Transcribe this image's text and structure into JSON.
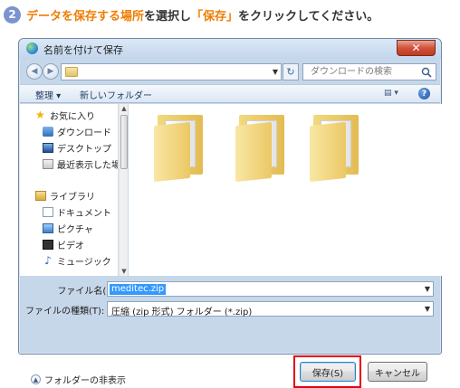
{
  "step": {
    "number": "2",
    "text_part1": "データを保存する場所",
    "text_part2": "を選択し",
    "text_part3": "「保存」",
    "text_part4": "をクリックしてください。"
  },
  "dialog": {
    "title": "名前を付けて保存",
    "close_glyph": "✕",
    "back_glyph": "◀",
    "forward_glyph": "▶",
    "address_dropdown_glyph": "▼",
    "refresh_glyph": "↻",
    "search_placeholder": "ダウンロードの検索"
  },
  "commandbar": {
    "organize_label": "整理 ▾",
    "new_folder_label": "新しいフォルダー",
    "views_label": "▤ ▾",
    "help_glyph": "?"
  },
  "sidebar": {
    "items": [
      {
        "label": "お気に入り",
        "icon": "star-icon"
      },
      {
        "label": "ダウンロード",
        "icon": "download-icon"
      },
      {
        "label": "デスクトップ",
        "icon": "desktop-icon"
      },
      {
        "label": "最近表示した場所",
        "icon": "recent-places-icon"
      },
      {
        "label": "ライブラリ",
        "icon": "library-icon"
      },
      {
        "label": "ドキュメント",
        "icon": "documents-icon"
      },
      {
        "label": "ピクチャ",
        "icon": "pictures-icon"
      },
      {
        "label": "ビデオ",
        "icon": "videos-icon"
      },
      {
        "label": "ミュージック",
        "icon": "music-icon"
      }
    ]
  },
  "form": {
    "filename_label": "ファイル名(N):",
    "filename_value": "meditec.zip",
    "filetype_label": "ファイルの種類(T):",
    "filetype_value": "圧縮 (zip 形式) フォルダー (*.zip)",
    "dropdown_glyph": "▼"
  },
  "footer": {
    "hide_folders_label": "フォルダーの非表示",
    "save_label": "保存(S)",
    "cancel_label": "キャンセル"
  },
  "colors": {
    "accent_orange": "#ee7d00",
    "highlight_red": "#e60012",
    "step_badge": "#7b93cf"
  }
}
